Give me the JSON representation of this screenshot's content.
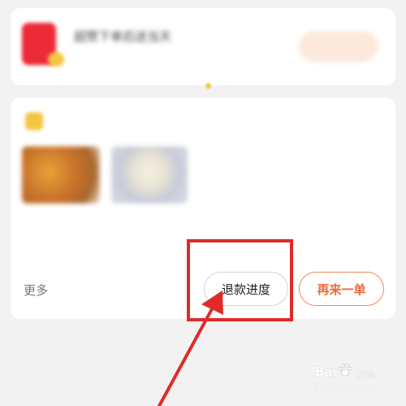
{
  "promo_card": {
    "title": "超赞下单后送当天",
    "subtitle": "",
    "button_label": "",
    "colors": {
      "icon": "#ec2a38",
      "button_bg": "#fde9dc",
      "button_text": "#f2764a"
    }
  },
  "order_card": {
    "shop_name": "",
    "status": "",
    "items": [
      {
        "name": ""
      },
      {
        "name": ""
      }
    ],
    "price": "",
    "count": "",
    "time": "",
    "more_label": "更多",
    "refund_label": "退款进度",
    "reorder_label": "再来一单",
    "colors": {
      "accent": "#ef6a33"
    }
  },
  "footer": {
    "hint": "",
    "link": ""
  },
  "annotation": {
    "color": "#e02a2a"
  },
  "watermark": {
    "brand": "Bai",
    "suffix": "经验",
    "url": "jingyan.baidu.com"
  }
}
